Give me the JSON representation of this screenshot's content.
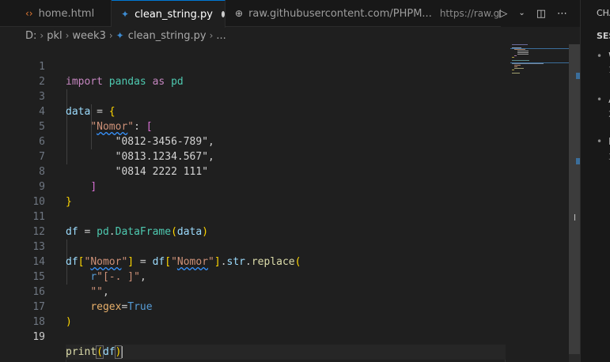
{
  "tabs": [
    {
      "label": "home.html",
      "icon": "html-icon"
    },
    {
      "label": "clean_string.py",
      "icon": "python-icon",
      "modified": true
    },
    {
      "label": "raw.githubusercontent.com/PHPM...",
      "extra": "https://raw.githubus",
      "icon": "globe-icon"
    }
  ],
  "breadcrumb": [
    "D:",
    "pkl",
    "week3",
    "clean_string.py",
    "..."
  ],
  "editor": {
    "lines": [
      {
        "n": "1"
      },
      {
        "n": "2"
      },
      {
        "n": "3"
      },
      {
        "n": "4"
      },
      {
        "n": "5"
      },
      {
        "n": "6"
      },
      {
        "n": "7"
      },
      {
        "n": "8"
      },
      {
        "n": "9"
      },
      {
        "n": "10"
      },
      {
        "n": "11"
      },
      {
        "n": "12"
      },
      {
        "n": "13"
      },
      {
        "n": "14"
      },
      {
        "n": "15"
      },
      {
        "n": "16"
      },
      {
        "n": "17"
      },
      {
        "n": "18"
      },
      {
        "n": "19"
      }
    ],
    "tokens": {
      "import": "import",
      "pandas": "pandas",
      "as": "as",
      "pd": "pd",
      "data": "data",
      "eq": " = ",
      "lbrace": "{",
      "rbrace": "}",
      "nomor_q1": "\"",
      "nomor": "Nomor",
      "nomor_q2": "\"",
      "colon": ": ",
      "lbrack": "[",
      "rbrack": "]",
      "s1": "\"0812-3456-789\"",
      "s2": "\"0813.1234.567\"",
      "s3": "\"0814 2222 111\"",
      "comma": ",",
      "df": "df",
      "pd2": "pd",
      "dot": ".",
      "DataFrame": "DataFrame",
      "lpar": "(",
      "rpar": ")",
      "data_arg": "data",
      "str": "str",
      "replace": "replace",
      "r_pre": "r",
      "regex_str": "\"[-. ]\"",
      "empty_str": "\"\"",
      "regex_kw": "regex",
      "eq_no_space": "=",
      "True": "True",
      "print": "print"
    }
  },
  "right_panel": {
    "title": "CHA",
    "section": "SES",
    "items": [
      {
        "label": "W",
        "sub": "1"
      },
      {
        "label": "A",
        "sub": "2"
      },
      {
        "label": "E",
        "sub": "3"
      }
    ]
  },
  "colors": {
    "accent": "#0078d4",
    "editor_bg": "#1f1f1f",
    "tabbar_bg": "#181818"
  }
}
